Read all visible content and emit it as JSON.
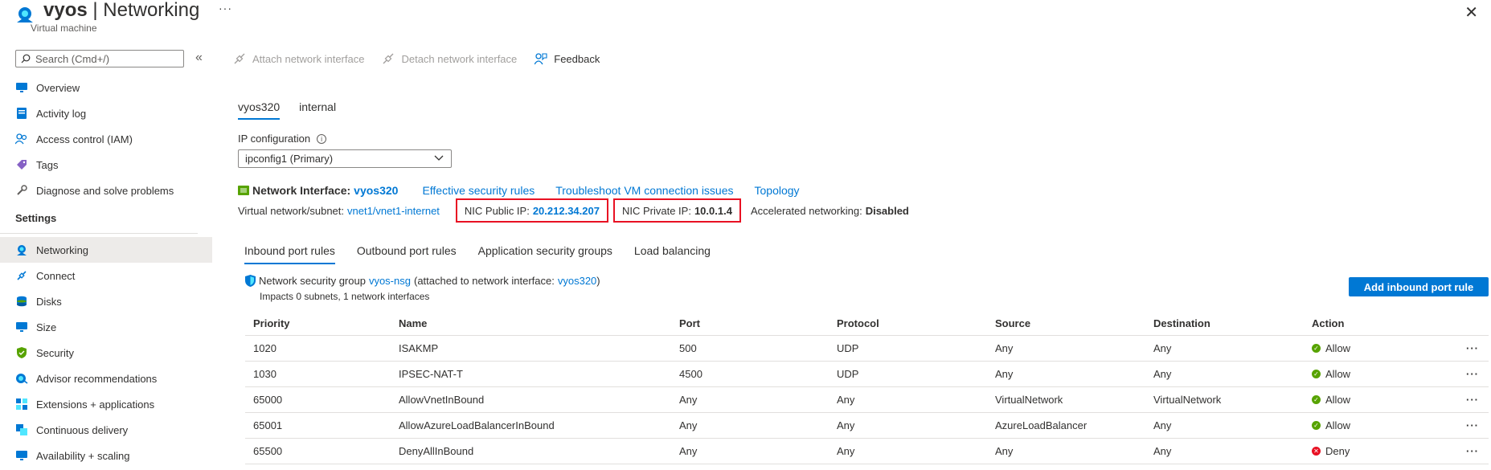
{
  "header": {
    "vm_name": "vyos",
    "title_sep": " | ",
    "section": "Networking",
    "subtitle": "Virtual machine",
    "more": "···",
    "close": "✕"
  },
  "sidebar": {
    "search_placeholder": "Search (Cmd+/)",
    "collapse": "«",
    "items": [
      {
        "label": "Overview",
        "icon": "monitor-icon"
      },
      {
        "label": "Activity log",
        "icon": "activity-log-icon"
      },
      {
        "label": "Access control (IAM)",
        "icon": "people-icon"
      },
      {
        "label": "Tags",
        "icon": "tag-icon"
      },
      {
        "label": "Diagnose and solve problems",
        "icon": "wrench-icon"
      }
    ],
    "settings_heading": "Settings",
    "settings_items": [
      {
        "label": "Networking",
        "icon": "networking-icon",
        "active": true
      },
      {
        "label": "Connect",
        "icon": "connect-icon"
      },
      {
        "label": "Disks",
        "icon": "disks-icon"
      },
      {
        "label": "Size",
        "icon": "monitor-icon"
      },
      {
        "label": "Security",
        "icon": "shield-icon"
      },
      {
        "label": "Advisor recommendations",
        "icon": "advisor-icon"
      },
      {
        "label": "Extensions + applications",
        "icon": "extensions-icon"
      },
      {
        "label": "Continuous delivery",
        "icon": "delivery-icon"
      },
      {
        "label": "Availability + scaling",
        "icon": "scaling-icon"
      }
    ]
  },
  "toolbar": {
    "attach": "Attach network interface",
    "detach": "Detach network interface",
    "feedback": "Feedback"
  },
  "nic_tabs": [
    "vyos320",
    "internal"
  ],
  "ip_config": {
    "label": "IP configuration",
    "value": "ipconfig1 (Primary)"
  },
  "network_interface": {
    "label": "Network Interface:",
    "name": "vyos320",
    "links": [
      "Effective security rules",
      "Troubleshoot VM connection issues",
      "Topology"
    ]
  },
  "vnet": {
    "label": "Virtual network/subnet:",
    "value": "vnet1/vnet1-internet",
    "public_ip_label": "NIC Public IP:",
    "public_ip": "20.212.34.207",
    "private_ip_label": "NIC Private IP:",
    "private_ip": "10.0.1.4",
    "accel_label": "Accelerated networking:",
    "accel_value": "Disabled"
  },
  "rule_tabs": [
    "Inbound port rules",
    "Outbound port rules",
    "Application security groups",
    "Load balancing"
  ],
  "nsg": {
    "prefix": "Network security group",
    "name": "vyos-nsg",
    "middle": "(attached to network interface:",
    "nic": "vyos320",
    "suffix": ")",
    "impacts": "Impacts 0 subnets, 1 network interfaces",
    "add_button": "Add inbound port rule"
  },
  "table": {
    "columns": [
      "Priority",
      "Name",
      "Port",
      "Protocol",
      "Source",
      "Destination",
      "Action"
    ],
    "rows": [
      {
        "priority": "1020",
        "name": "ISAKMP",
        "port": "500",
        "protocol": "UDP",
        "source": "Any",
        "destination": "Any",
        "action": "Allow"
      },
      {
        "priority": "1030",
        "name": "IPSEC-NAT-T",
        "port": "4500",
        "protocol": "UDP",
        "source": "Any",
        "destination": "Any",
        "action": "Allow"
      },
      {
        "priority": "65000",
        "name": "AllowVnetInBound",
        "port": "Any",
        "protocol": "Any",
        "source": "VirtualNetwork",
        "destination": "VirtualNetwork",
        "action": "Allow"
      },
      {
        "priority": "65001",
        "name": "AllowAzureLoadBalancerInBound",
        "port": "Any",
        "protocol": "Any",
        "source": "AzureLoadBalancer",
        "destination": "Any",
        "action": "Allow"
      },
      {
        "priority": "65500",
        "name": "DenyAllInBound",
        "port": "Any",
        "protocol": "Any",
        "source": "Any",
        "destination": "Any",
        "action": "Deny"
      }
    ],
    "more": "···"
  },
  "colors": {
    "accent": "#0078d4",
    "allow": "#57a300",
    "deny": "#e81123",
    "highlight_box": "#e81123"
  }
}
